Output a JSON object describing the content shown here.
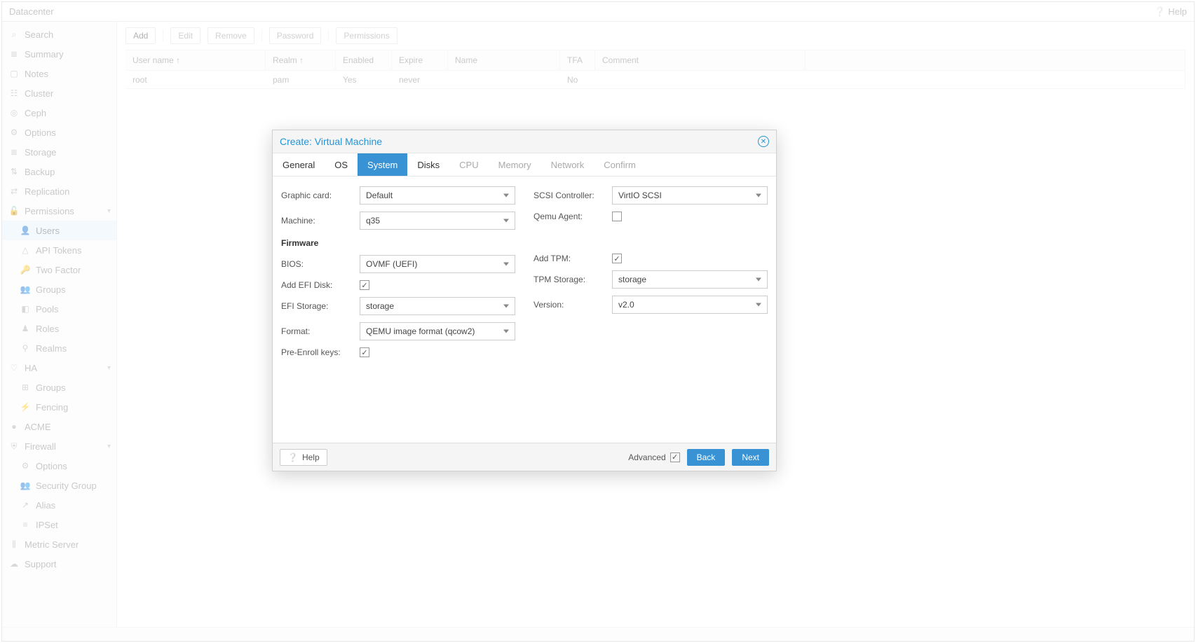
{
  "header": {
    "title": "Datacenter",
    "help": "Help"
  },
  "sidebar": {
    "items": [
      {
        "label": "Search",
        "icon": "⌕"
      },
      {
        "label": "Summary",
        "icon": "≣"
      },
      {
        "label": "Notes",
        "icon": "▢"
      },
      {
        "label": "Cluster",
        "icon": "☷"
      },
      {
        "label": "Ceph",
        "icon": "◎"
      },
      {
        "label": "Options",
        "icon": "⚙"
      },
      {
        "label": "Storage",
        "icon": "≣"
      },
      {
        "label": "Backup",
        "icon": "⇅"
      },
      {
        "label": "Replication",
        "icon": "⇄"
      },
      {
        "label": "Permissions",
        "icon": "🔓",
        "expandable": true
      },
      {
        "label": "Users",
        "icon": "👤",
        "sub": true,
        "selected": true
      },
      {
        "label": "API Tokens",
        "icon": "△",
        "sub": true
      },
      {
        "label": "Two Factor",
        "icon": "🔑",
        "sub": true
      },
      {
        "label": "Groups",
        "icon": "👥",
        "sub": true
      },
      {
        "label": "Pools",
        "icon": "◧",
        "sub": true
      },
      {
        "label": "Roles",
        "icon": "♟",
        "sub": true
      },
      {
        "label": "Realms",
        "icon": "⚲",
        "sub": true
      },
      {
        "label": "HA",
        "icon": "♡",
        "expandable": true
      },
      {
        "label": "Groups",
        "icon": "⊞",
        "sub": true
      },
      {
        "label": "Fencing",
        "icon": "⚡",
        "sub": true
      },
      {
        "label": "ACME",
        "icon": "●"
      },
      {
        "label": "Firewall",
        "icon": "⛨",
        "expandable": true
      },
      {
        "label": "Options",
        "icon": "⚙",
        "sub": true
      },
      {
        "label": "Security Group",
        "icon": "👥",
        "sub": true
      },
      {
        "label": "Alias",
        "icon": "↗",
        "sub": true
      },
      {
        "label": "IPSet",
        "icon": "≡",
        "sub": true
      },
      {
        "label": "Metric Server",
        "icon": "⫼"
      },
      {
        "label": "Support",
        "icon": "☁"
      }
    ]
  },
  "toolbar": {
    "add": "Add",
    "edit": "Edit",
    "remove": "Remove",
    "password": "Password",
    "permissions": "Permissions"
  },
  "table": {
    "headers": [
      "User name ↑",
      "Realm ↑",
      "Enabled",
      "Expire",
      "Name",
      "TFA",
      "Comment"
    ],
    "widths": [
      200,
      100,
      80,
      80,
      160,
      50,
      300
    ],
    "row": [
      "root",
      "pam",
      "Yes",
      "never",
      "",
      "No",
      ""
    ]
  },
  "dialog": {
    "title": "Create: Virtual Machine",
    "tabs": [
      {
        "label": "General"
      },
      {
        "label": "OS"
      },
      {
        "label": "System",
        "active": true
      },
      {
        "label": "Disks"
      },
      {
        "label": "CPU",
        "disabled": true
      },
      {
        "label": "Memory",
        "disabled": true
      },
      {
        "label": "Network",
        "disabled": true
      },
      {
        "label": "Confirm",
        "disabled": true
      }
    ],
    "left": {
      "graphic_label": "Graphic card:",
      "graphic_val": "Default",
      "machine_label": "Machine:",
      "machine_val": "q35",
      "firmware_head": "Firmware",
      "bios_label": "BIOS:",
      "bios_val": "OVMF (UEFI)",
      "efi_label": "Add EFI Disk:",
      "efi_checked": true,
      "efistore_label": "EFI Storage:",
      "efistore_val": "storage",
      "format_label": "Format:",
      "format_val": "QEMU image format (qcow2)",
      "preenroll_label": "Pre-Enroll keys:",
      "preenroll_checked": true
    },
    "right": {
      "scsi_label": "SCSI Controller:",
      "scsi_val": "VirtIO SCSI",
      "qemu_label": "Qemu Agent:",
      "qemu_checked": false,
      "tpm_label": "Add TPM:",
      "tpm_checked": true,
      "tpmstore_label": "TPM Storage:",
      "tpmstore_val": "storage",
      "version_label": "Version:",
      "version_val": "v2.0"
    },
    "footer": {
      "help": "Help",
      "advanced": "Advanced",
      "adv_checked": true,
      "back": "Back",
      "next": "Next"
    }
  }
}
